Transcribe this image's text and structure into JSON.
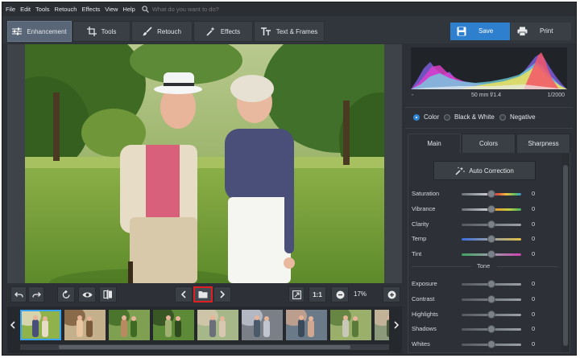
{
  "menu": [
    "File",
    "Edit",
    "Tools",
    "Retouch",
    "Effects",
    "View",
    "Help"
  ],
  "search": {
    "placeholder": "What do you want to do?"
  },
  "tabs": [
    {
      "label": "Enhancement",
      "icon": "sliders-icon"
    },
    {
      "label": "Tools",
      "icon": "crop-icon"
    },
    {
      "label": "Retouch",
      "icon": "brush-icon"
    },
    {
      "label": "Effects",
      "icon": "magic-wand-icon"
    },
    {
      "label": "Text & Frames",
      "icon": "text-icon"
    }
  ],
  "actions": {
    "save": "Save",
    "print": "Print"
  },
  "exif": {
    "left": "-",
    "mid": "50 mm f/1.4",
    "right": "1/2000"
  },
  "color_modes": {
    "items": [
      "Color",
      "Black & White",
      "Negative"
    ],
    "selected": "Color"
  },
  "panel_tabs": {
    "items": [
      "Main",
      "Colors",
      "Sharpness"
    ],
    "active": "Main"
  },
  "auto_correction": "Auto Correction",
  "main_sliders": [
    {
      "label": "Saturation",
      "value": "0"
    },
    {
      "label": "Vibrance",
      "value": "0"
    },
    {
      "label": "Clarity",
      "value": "0"
    },
    {
      "label": "Temp",
      "value": "0"
    },
    {
      "label": "Tint",
      "value": "0"
    }
  ],
  "tone_label": "Tone",
  "tone_sliders": [
    {
      "label": "Exposure",
      "value": "0"
    },
    {
      "label": "Contrast",
      "value": "0"
    },
    {
      "label": "Highlights",
      "value": "0"
    },
    {
      "label": "Shadows",
      "value": "0"
    },
    {
      "label": "Whites",
      "value": "0"
    }
  ],
  "zoom": {
    "actual": "1:1",
    "level": "17%"
  },
  "filmstrip_count": 9,
  "colors": {
    "accent": "#2f7fcf",
    "highlight": "#e02020",
    "active_tab": "#596678"
  }
}
